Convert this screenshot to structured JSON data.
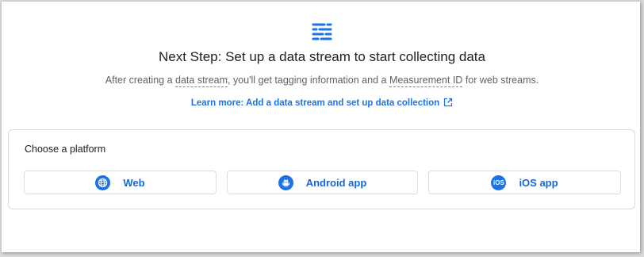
{
  "colors": {
    "accent": "#1a73e8",
    "link": "#1a73e8",
    "text": "#202124",
    "muted": "#5f6368",
    "border": "#dadce0"
  },
  "header": {
    "icon": "data-stream-icon",
    "title": "Next Step: Set up a data stream to start collecting data",
    "subtitle": {
      "part1": "After creating a ",
      "term1": "data stream",
      "part2": ", you'll get tagging information and a ",
      "term2": "Measurement ID",
      "part3": " for web streams."
    },
    "learn_more": "Learn more: Add a data stream and set up data collection",
    "learn_more_icon": "open-in-new-icon"
  },
  "platforms": {
    "heading": "Choose a platform",
    "buttons": [
      {
        "label": "Web",
        "icon": "globe-icon"
      },
      {
        "label": "Android app",
        "icon": "android-icon"
      },
      {
        "label": "iOS app",
        "icon": "ios-icon",
        "icon_text": "iOS"
      }
    ]
  }
}
